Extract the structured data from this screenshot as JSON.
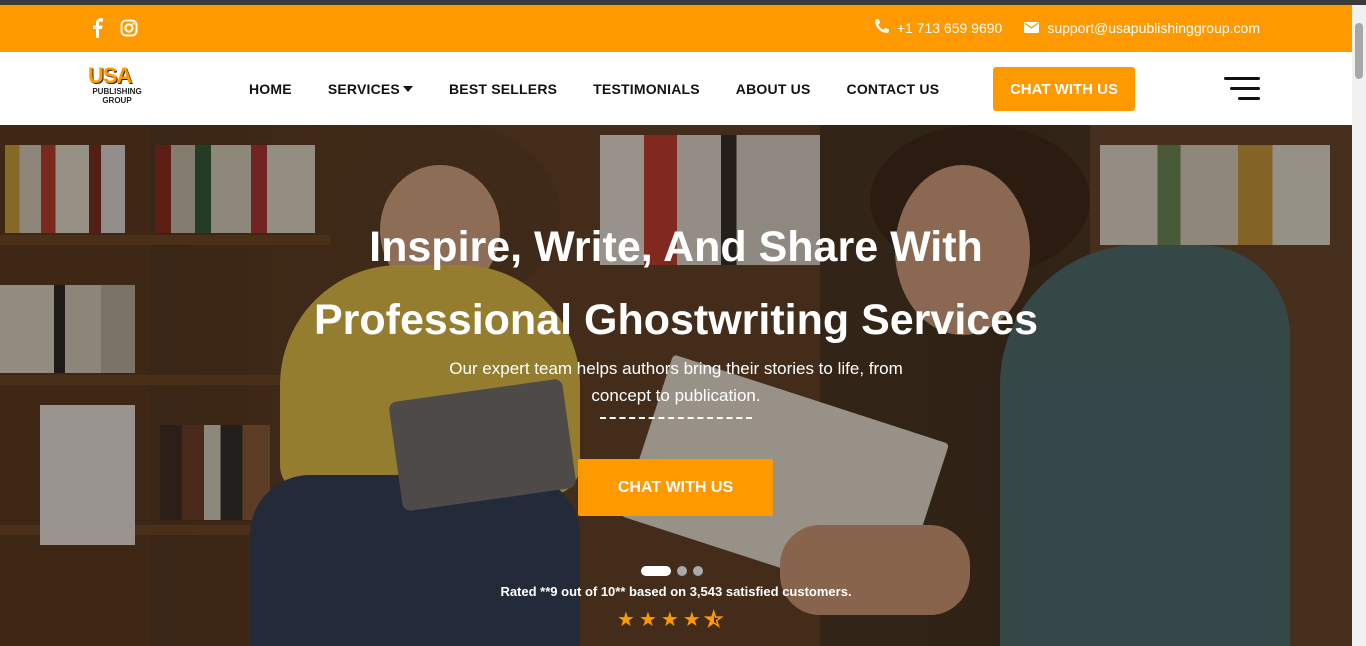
{
  "topbar": {
    "phone": "+1 713 659 9690",
    "email": "support@usapublishinggroup.com",
    "social_icons": [
      "facebook-icon",
      "instagram-icon"
    ]
  },
  "logo": {
    "mark": "USA",
    "line1": "PUBLISHING",
    "line2": "GROUP"
  },
  "nav": {
    "items": [
      "HOME",
      "SERVICES",
      "BEST SELLERS",
      "TESTIMONIALS",
      "ABOUT US",
      "CONTACT US"
    ],
    "cta": "CHAT WITH US"
  },
  "hero": {
    "title_line1": "Inspire, Write, And Share With",
    "title_line2": "Professional Ghostwriting Services",
    "subtitle": "Our expert team helps authors bring their stories to life, from concept to publication.",
    "cta": "CHAT WITH US",
    "rating_text": "Rated **9 out of 10** based on 3,543 satisfied customers.",
    "stars": 4.5,
    "slides": 3,
    "active_slide": 1
  },
  "colors": {
    "brand": "#ff9900",
    "nav_text": "#111111"
  }
}
